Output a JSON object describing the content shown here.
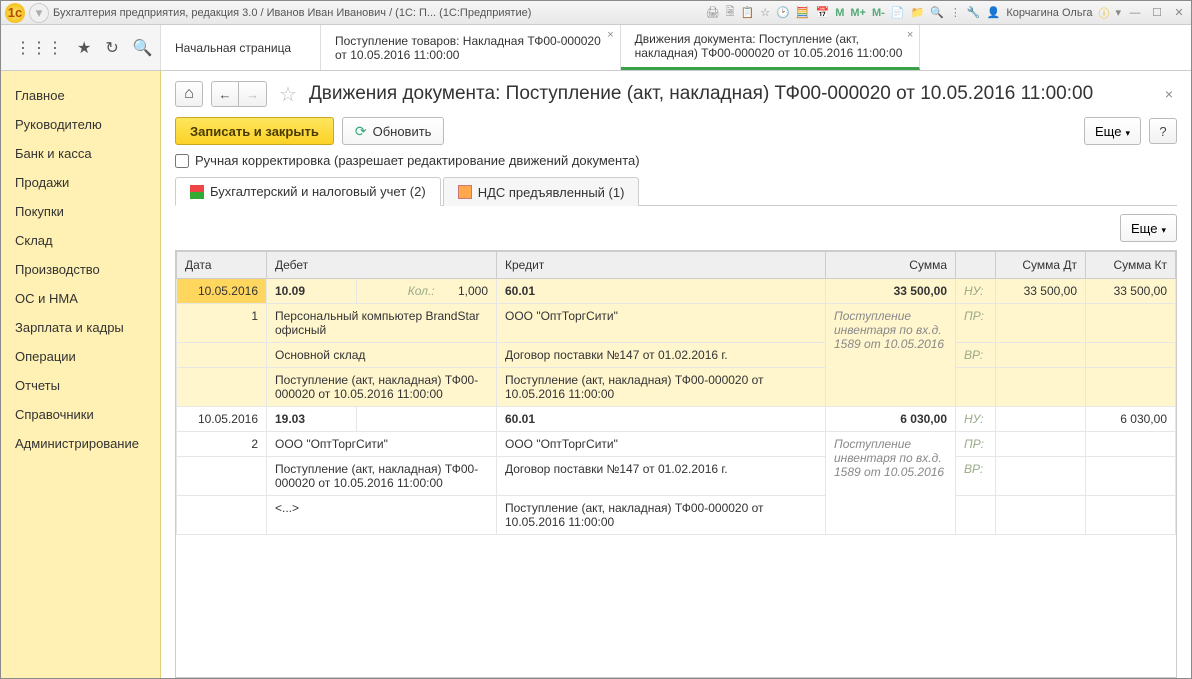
{
  "titlebar": {
    "app_title": "Бухгалтерия предприятия, редакция 3.0 / Иванов Иван Иванович / (1С: П...  (1С:Предприятие)",
    "m_labels": [
      "M",
      "M+",
      "M-"
    ],
    "user_name": "Корчагина Ольга"
  },
  "tabs": {
    "home": "Начальная страница",
    "tab1": "Поступление товаров: Накладная ТФ00-000020 от 10.05.2016 11:00:00",
    "tab2": "Движения документа: Поступление (акт, накладная) ТФ00-000020 от 10.05.2016 11:00:00"
  },
  "sidebar": {
    "items": [
      "Главное",
      "Руководителю",
      "Банк и касса",
      "Продажи",
      "Покупки",
      "Склад",
      "Производство",
      "ОС и НМА",
      "Зарплата и кадры",
      "Операции",
      "Отчеты",
      "Справочники",
      "Администрирование"
    ]
  },
  "page": {
    "title": "Движения документа: Поступление (акт, накладная) ТФ00-000020 от 10.05.2016 11:00:00",
    "save_close": "Записать и закрыть",
    "refresh": "Обновить",
    "more": "Еще",
    "help": "?",
    "manual_edit": "Ручная корректировка (разрешает редактирование движений документа)"
  },
  "inner_tabs": {
    "tab1": "Бухгалтерский и налоговый учет (2)",
    "tab2": "НДС предъявленный (1)"
  },
  "grid": {
    "headers": {
      "date": "Дата",
      "debit": "Дебет",
      "credit": "Кредит",
      "sum": "Сумма",
      "sum_dt": "Сумма Дт",
      "sum_kt": "Сумма Кт"
    },
    "kol_label": "Кол.:",
    "nu_label": "НУ:",
    "pr_label": "ПР:",
    "vr_label": "ВР:",
    "rows": [
      {
        "date": "10.05.2016",
        "n": "1",
        "debit_acc": "10.09",
        "qty": "1,000",
        "debit_lines": [
          "Персональный компьютер BrandStar офисный",
          "Основной склад",
          "Поступление (акт, накладная) ТФ00-000020 от 10.05.2016 11:00:00"
        ],
        "credit_acc": "60.01",
        "credit_lines": [
          "ООО \"ОптТоргСити\"",
          "Договор поставки №147 от 01.02.2016 г.",
          "Поступление (акт, накладная) ТФ00-000020 от 10.05.2016 11:00:00"
        ],
        "sum": "33 500,00",
        "sum_desc": "Поступление инвентаря по вх.д. 1589 от 10.05.2016",
        "sum_dt": "33 500,00",
        "sum_kt": "33 500,00"
      },
      {
        "date": "10.05.2016",
        "n": "2",
        "debit_acc": "19.03",
        "qty": "",
        "debit_lines": [
          "ООО \"ОптТоргСити\"",
          "Поступление (акт, накладная) ТФ00-000020 от 10.05.2016 11:00:00",
          "<...>"
        ],
        "credit_acc": "60.01",
        "credit_lines": [
          "ООО \"ОптТоргСити\"",
          "Договор поставки №147 от 01.02.2016 г.",
          "Поступление (акт, накладная) ТФ00-000020 от 10.05.2016 11:00:00"
        ],
        "sum": "6 030,00",
        "sum_desc": "Поступление инвентаря по вх.д. 1589 от 10.05.2016",
        "sum_dt": "",
        "sum_kt": "6 030,00"
      }
    ]
  }
}
